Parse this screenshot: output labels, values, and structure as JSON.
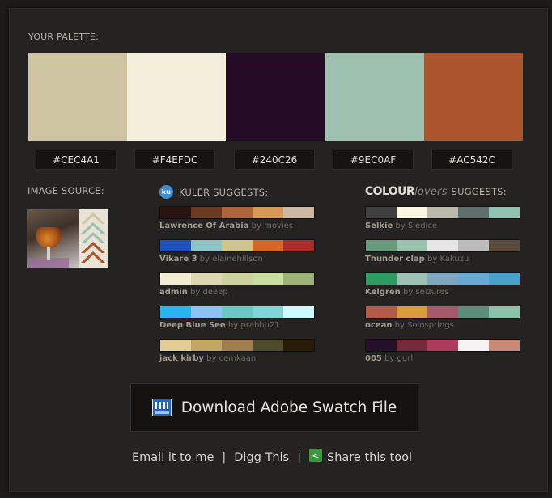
{
  "palette": {
    "title": "YOUR PALETTE:",
    "colors": [
      "#CEC4A1",
      "#F4EFDC",
      "#240C26",
      "#9EC0AF",
      "#AC542C"
    ]
  },
  "columns": {
    "image_source_title": "IMAGE SOURCE:",
    "kuler_title": "KULER SUGGESTS:",
    "kuler_logo_text": "ku",
    "colourlovers_colour": "COLOUR",
    "colourlovers_lovers": "lovers",
    "colourlovers_suffix": "SUGGESTS:"
  },
  "kuler": [
    {
      "name": "Lawrence Of Arabia",
      "by": "by",
      "author": "movies",
      "colors": [
        "#2a1410",
        "#6b3a22",
        "#b0643a",
        "#d89a52",
        "#cdb8a2"
      ]
    },
    {
      "name": "Vikare 3",
      "by": "by",
      "author": "elainehillson",
      "colors": [
        "#1f4fb8",
        "#8fc4c8",
        "#cfc48a",
        "#d4662a",
        "#a92e2a"
      ]
    },
    {
      "name": "admin",
      "by": "by",
      "author": "deeep",
      "colors": [
        "#f2ecd2",
        "#dcd7b0",
        "#cdd29c",
        "#c9dfa0",
        "#9eb278"
      ]
    },
    {
      "name": "Deep Blue See",
      "by": "by",
      "author": "prabhu21",
      "colors": [
        "#27b4f0",
        "#8ec2f4",
        "#6ac8c4",
        "#7ed6d8",
        "#ccfaff"
      ]
    },
    {
      "name": "jack kirby",
      "by": "by",
      "author": "cemkaan",
      "colors": [
        "#e0cc94",
        "#c2a764",
        "#a17d52",
        "#4e4a2c",
        "#2a1a08"
      ]
    }
  ],
  "colourlovers": [
    {
      "name": "Selkie",
      "by": "by",
      "author": "Siedice",
      "colors": [
        "#3f3f3f",
        "#faf6e0",
        "#b8b9a8",
        "#5e6f6c",
        "#8fc2b0"
      ]
    },
    {
      "name": "Thunder clap",
      "by": "by",
      "author": "Kakuzu",
      "colors": [
        "#6a9a7c",
        "#9cc2ad",
        "#e6e6e6",
        "#bcbcbc",
        "#5a4a3c"
      ]
    },
    {
      "name": "Kelgren",
      "by": "by",
      "author": "seizures",
      "colors": [
        "#2e9c62",
        "#9cc0b4",
        "#7fa6c0",
        "#6aa8d4",
        "#4aa2cc"
      ]
    },
    {
      "name": "ocean",
      "by": "by",
      "author": "Solosprings",
      "colors": [
        "#b45a4a",
        "#d89c3c",
        "#a45a6c",
        "#5e8c78",
        "#8cc0a8"
      ]
    },
    {
      "name": "005",
      "by": "by",
      "author": "gurl",
      "colors": [
        "#24102a",
        "#742a3a",
        "#b03a5c",
        "#f4f2f2",
        "#c88a78"
      ]
    }
  ],
  "download": {
    "label": "Download Adobe Swatch File",
    "icon": "swatch-file-icon"
  },
  "footer": {
    "email": "Email it to me",
    "sep": "|",
    "digg": "Digg This",
    "share": "Share this tool",
    "share_icon": "share-icon"
  }
}
